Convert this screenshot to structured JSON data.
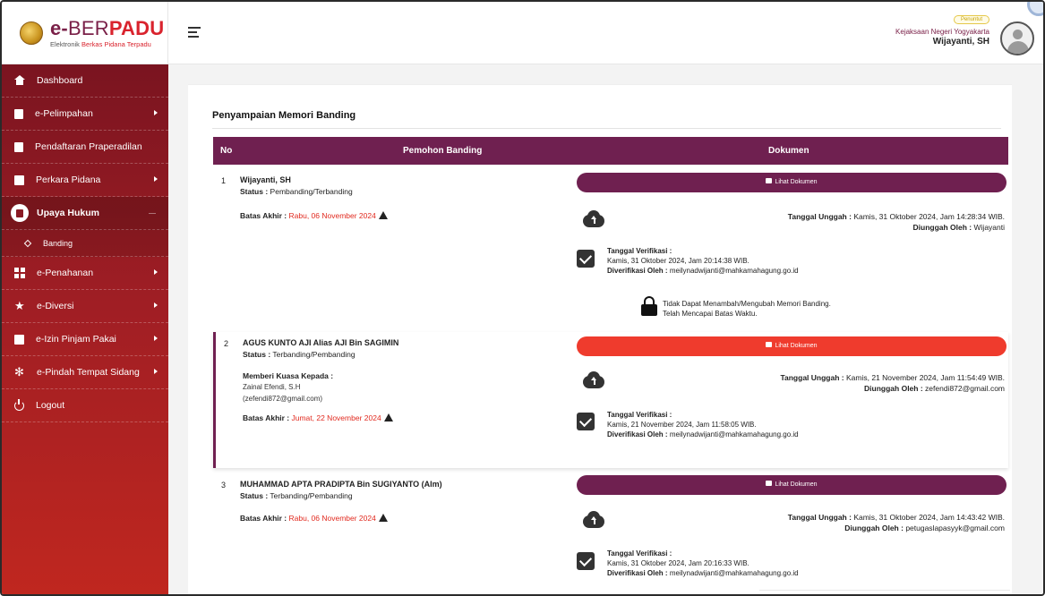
{
  "brand": {
    "logo_e": "e-",
    "logo_ber": "BER",
    "logo_padu": "PADU",
    "subtitle_a": "Elektronik ",
    "subtitle_b": "Berkas Pidana",
    "subtitle_c": " Terpadu"
  },
  "user": {
    "role": "Penuntut",
    "office": "Kejaksaan Negeri Yogyakarta",
    "name": "Wijayanti, SH"
  },
  "sidebar": {
    "items": [
      {
        "label": "Dashboard"
      },
      {
        "label": "e-Pelimpahan"
      },
      {
        "label": "Pendaftaran Praperadilan"
      },
      {
        "label": "Perkara Pidana"
      },
      {
        "label": "Upaya Hukum"
      },
      {
        "label": "Banding"
      },
      {
        "label": "e-Penahanan"
      },
      {
        "label": "e-Diversi"
      },
      {
        "label": "e-Izin Pinjam Pakai"
      },
      {
        "label": "e-Pindah Tempat Sidang"
      },
      {
        "label": "Logout"
      }
    ]
  },
  "page": {
    "title": "Penyampaian Memori Banding"
  },
  "table": {
    "headers": [
      "No",
      "Pemohon Banding",
      "Dokumen"
    ],
    "labels": {
      "status": "Status :",
      "deadline": "Batas Akhir :",
      "upload_date": "Tanggal Unggah :",
      "uploaded_by": "Diunggah Oleh :",
      "verif_date": "Tanggal Verifikasi :",
      "verified_by": "Diverifikasi Oleh :",
      "kuasa": "Memberi Kuasa Kepada :",
      "view_doc": "Lihat Dokumen"
    },
    "rows": [
      {
        "no": "1",
        "name": "Wijayanti, SH",
        "status": "Pembanding/Terbanding",
        "deadline": "Rabu, 06 November 2024",
        "upload_date": "Kamis, 31 Oktober 2024, Jam 14:28:34 WIB.",
        "uploaded_by": "Wijayanti",
        "verif_date": "Kamis, 31 Oktober 2024, Jam 20:14:38 WIB.",
        "verified_by": "meilynadwijanti@mahkamahagung.go.id",
        "lock_line1": "Tidak Dapat Menambah/Mengubah Memori Banding.",
        "lock_line2": "Telah Mencapai Batas Waktu."
      },
      {
        "no": "2",
        "name": "AGUS KUNTO AJI Alias AJI Bin SAGIMIN",
        "status": "Terbanding/Pembanding",
        "kuasa_name": "Zainal Efendi, S.H",
        "kuasa_email": "(zefendi872@gmail.com)",
        "deadline": "Jumat, 22 November 2024",
        "upload_date": "Kamis, 21 November 2024, Jam 11:54:49 WIB.",
        "uploaded_by": "zefendi872@gmail.com",
        "verif_date": "Kamis, 21 November 2024, Jam 11:58:05 WIB.",
        "verified_by": "meilynadwijanti@mahkamahagung.go.id"
      },
      {
        "no": "3",
        "name": "MUHAMMAD APTA PRADIPTA Bin SUGIYANTO (Alm)",
        "status": "Terbanding/Pembanding",
        "deadline": "Rabu, 06 November 2024",
        "upload_date": "Kamis, 31 Oktober 2024, Jam 14:43:42 WIB.",
        "uploaded_by": "petugaslapasyyk@gmail.com",
        "verif_date": "Kamis, 31 Oktober 2024, Jam 20:16:33 WIB.",
        "verified_by": "meilynadwijanti@mahkamahagung.go.id"
      }
    ]
  },
  "colors": {
    "brand_maroon": "#6f2050",
    "accent_red": "#ef3b2d",
    "deadline_red": "#e12a1f",
    "sidebar_top": "#7a1420",
    "sidebar_bottom": "#c0271f"
  },
  "icons": {
    "dashboard": "home-icon",
    "pelimpahan": "document-icon",
    "praperadilan": "document-icon",
    "perkara": "pencil-icon",
    "upaya": "copy-icon",
    "penahanan": "grid-icon",
    "diversi": "star-icon",
    "izin": "pencil-icon",
    "pindah": "gear-icon",
    "logout": "power-icon",
    "upload": "cloud-upload-icon",
    "verified": "check-icon",
    "locked": "lock-icon"
  }
}
